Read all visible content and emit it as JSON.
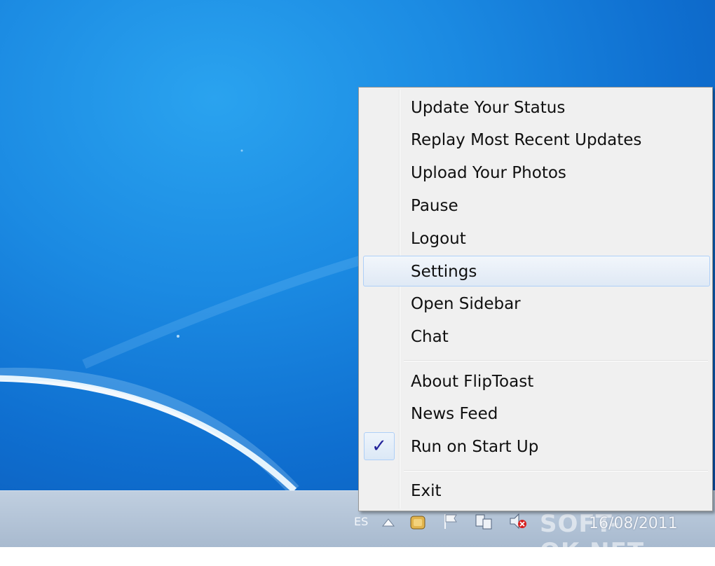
{
  "menu": {
    "items": [
      {
        "label": "Update Your Status"
      },
      {
        "label": "Replay Most Recent Updates"
      },
      {
        "label": "Upload Your Photos"
      },
      {
        "label": "Pause"
      },
      {
        "label": "Logout"
      },
      {
        "label": "Settings"
      },
      {
        "label": "Open Sidebar"
      },
      {
        "label": "Chat"
      },
      {
        "label": "About FlipToast"
      },
      {
        "label": "News Feed"
      },
      {
        "label": "Run on Start Up",
        "checked": true
      },
      {
        "label": "Exit"
      }
    ],
    "check_glyph": "✓"
  },
  "taskbar": {
    "lang": "ES",
    "clock": "16/08/2011",
    "tray_icons": [
      "show-hidden-icons-icon",
      "fliptoast-tray-icon",
      "action-center-flag-icon",
      "network-icon",
      "volume-muted-icon"
    ]
  },
  "watermark": "SOFT-OK.NET"
}
